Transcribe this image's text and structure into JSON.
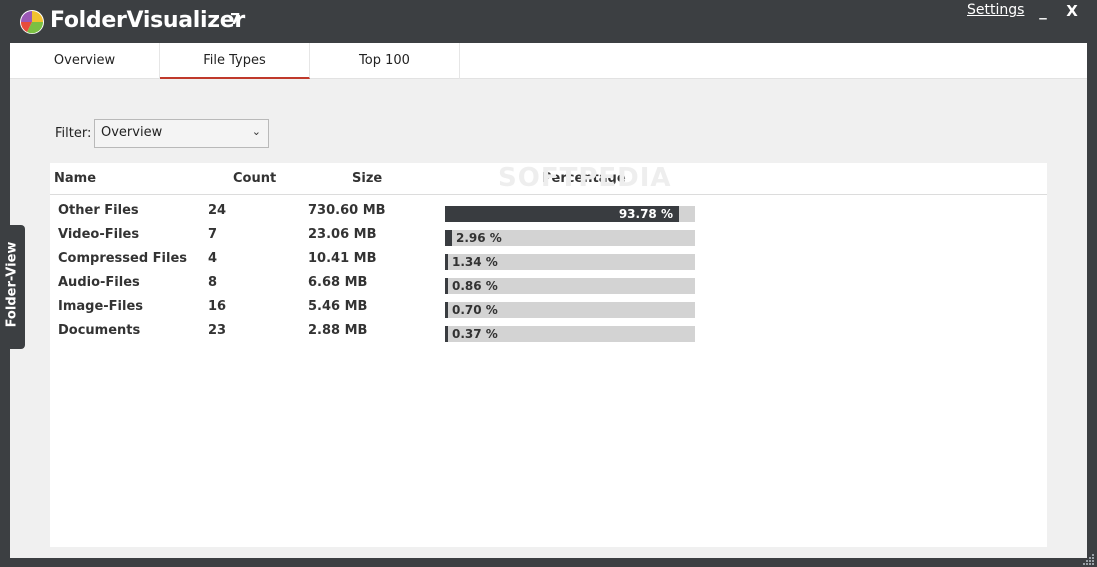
{
  "window": {
    "title": "FolderVisualizer",
    "version": "7",
    "settings_label": "Settings",
    "minimize_label": "_",
    "close_label": "X"
  },
  "tabs": [
    {
      "label": "Overview",
      "active": false
    },
    {
      "label": "File Types",
      "active": true
    },
    {
      "label": "Top 100",
      "active": false
    }
  ],
  "filter": {
    "label": "Filter:",
    "value": "Overview"
  },
  "table": {
    "columns": [
      "Name",
      "Count",
      "Size",
      "Percentage"
    ],
    "rows": [
      {
        "name": "Other Files",
        "count": "24",
        "size": "730.60 MB",
        "pct_text": "93.78 %",
        "pct": 93.78
      },
      {
        "name": "Video-Files",
        "count": "7",
        "size": "23.06 MB",
        "pct_text": "2.96 %",
        "pct": 2.96
      },
      {
        "name": "Compressed Files",
        "count": "4",
        "size": "10.41 MB",
        "pct_text": "1.34 %",
        "pct": 1.34
      },
      {
        "name": "Audio-Files",
        "count": "8",
        "size": "6.68 MB",
        "pct_text": "0.86 %",
        "pct": 0.86
      },
      {
        "name": "Image-Files",
        "count": "16",
        "size": "5.46 MB",
        "pct_text": "0.70 %",
        "pct": 0.7
      },
      {
        "name": "Documents",
        "count": "23",
        "size": "2.88 MB",
        "pct_text": "0.37 %",
        "pct": 0.37
      }
    ]
  },
  "watermark": "SOFTPEDIA",
  "side_tab": {
    "label": "Folder-View"
  },
  "colors": {
    "chrome": "#3c3f42",
    "bar_fill": "#393c40",
    "bar_track": "#d3d3d3",
    "active_tab_underline": "#c0392b"
  }
}
